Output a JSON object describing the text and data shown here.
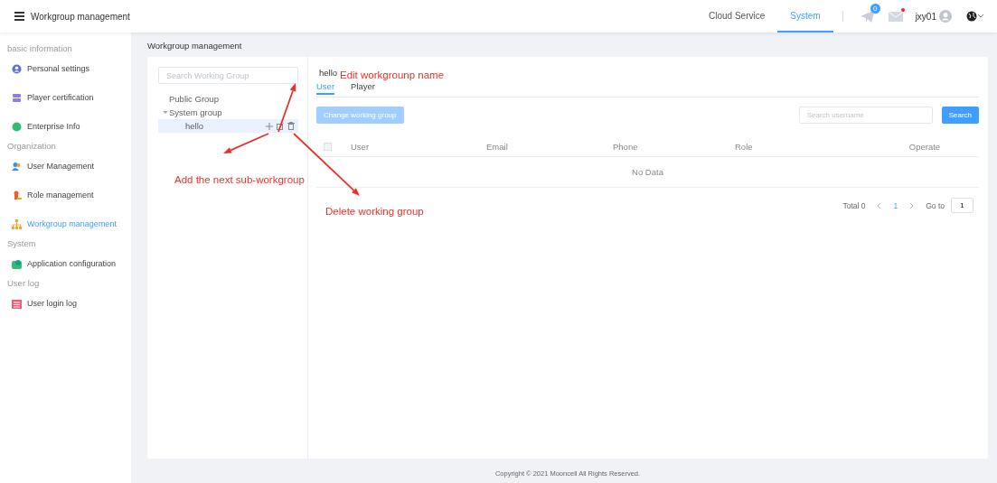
{
  "header": {
    "title": "Workgroup management",
    "nav": [
      {
        "label": "Cloud Service",
        "selected": false
      },
      {
        "label": "System",
        "selected": true
      }
    ],
    "notification_badge": "0",
    "mail_unread": true,
    "username": "jxy01"
  },
  "sidebar": {
    "groups": [
      {
        "title": "basic information",
        "items": [
          {
            "label": "Personal settings",
            "selected": false
          },
          {
            "label": "Player certification",
            "selected": false
          },
          {
            "label": "Enterprise Info",
            "selected": false
          }
        ]
      },
      {
        "title": "Organization",
        "items": [
          {
            "label": "User Management",
            "selected": false
          },
          {
            "label": "Role management",
            "selected": false
          },
          {
            "label": "Workgroup management",
            "selected": true
          }
        ]
      },
      {
        "title": "System",
        "items": [
          {
            "label": "Application configuration",
            "selected": false
          }
        ]
      },
      {
        "title": "User log",
        "items": [
          {
            "label": "User login log",
            "selected": false
          }
        ]
      }
    ]
  },
  "breadcrumb": "Workgroup management",
  "tree": {
    "search_placeholder": "Search Working Group",
    "nodes": [
      {
        "label": "Public Group",
        "selected": false
      },
      {
        "label": "System group",
        "selected": false,
        "expanded": true,
        "children": [
          {
            "label": "hello",
            "selected": true
          }
        ]
      }
    ]
  },
  "detail": {
    "title": "hello",
    "tabs": [
      {
        "label": "User",
        "selected": true
      },
      {
        "label": "Player",
        "selected": false
      }
    ],
    "change_button": {
      "label": "Change working group",
      "disabled": true
    },
    "search": {
      "placeholder": "Search username",
      "button": "Search"
    },
    "table": {
      "select_all_checked": false,
      "columns": [
        "User",
        "Email",
        "Phone",
        "Role",
        "Operate"
      ],
      "empty_text": "No Data"
    },
    "pagination": {
      "total": "Total 0",
      "pages": [
        {
          "label": "1",
          "selected": true
        }
      ],
      "goto_label": "Go to",
      "goto_value": "1"
    }
  },
  "annotations": [
    {
      "text": "Edit workgrounp name"
    },
    {
      "text": "Add the next sub-workgroup"
    },
    {
      "text": "Delete working group"
    }
  ],
  "footer": "Copyright © 2021 Mooncell All Rights Reserved."
}
